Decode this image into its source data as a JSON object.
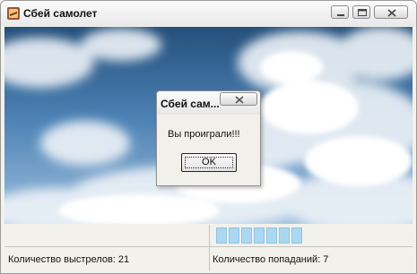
{
  "window": {
    "title": "Сбей самолет",
    "icons": {
      "app": "airplane-app-icon",
      "minimize": "minimize-icon",
      "maximize": "maximize-icon",
      "close": "close-icon"
    }
  },
  "game": {
    "background": "sky-with-clouds"
  },
  "status": {
    "shots_label": "Количество выстрелов: 21",
    "hits_label": "Количество попаданий: 7",
    "progress_segments": 7
  },
  "dialog": {
    "title": "Сбей сам...",
    "message": "Вы проиграли!!!",
    "ok_label": "OK"
  },
  "colors": {
    "sky_top": "#2a5d8c",
    "sky_mid": "#4f86b8",
    "progress_fill": "#a9d8f0"
  }
}
